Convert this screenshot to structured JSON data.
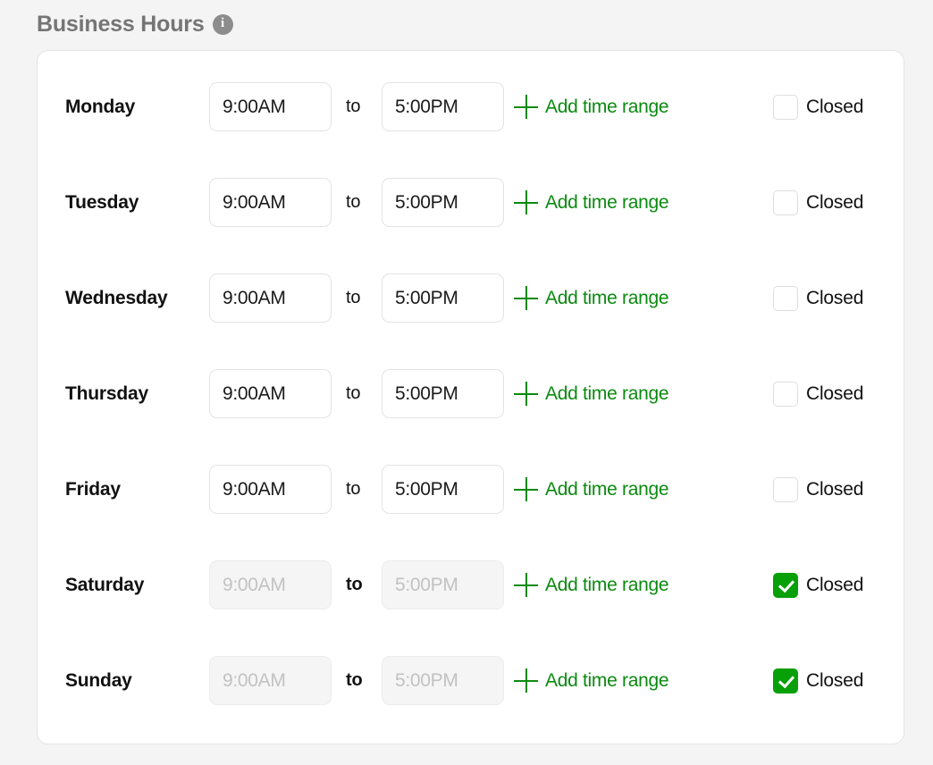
{
  "header": {
    "title": "Business Hours",
    "info_icon": "info-icon",
    "info_glyph": "i"
  },
  "labels": {
    "to": "to",
    "add_time_range": "Add time range",
    "closed": "Closed",
    "plus_icon": "plus-icon"
  },
  "colors": {
    "page_background": "#f4f4f4",
    "card_background": "#ffffff",
    "card_border": "#e4e4e4",
    "accent_green": "#0b8a10",
    "checkbox_checked": "#08a008",
    "title_gray": "#757575",
    "disabled_text": "#c2c2c2",
    "disabled_input_background": "#f5f5f5"
  },
  "rows": [
    {
      "day": "Monday",
      "start_time": "9:00AM",
      "end_time": "5:00PM",
      "add_time_range": "Add time range",
      "to": "to",
      "closed_label": "Closed",
      "closed": false,
      "disabled": false
    },
    {
      "day": "Tuesday",
      "start_time": "9:00AM",
      "end_time": "5:00PM",
      "add_time_range": "Add time range",
      "to": "to",
      "closed_label": "Closed",
      "closed": false,
      "disabled": false
    },
    {
      "day": "Wednesday",
      "start_time": "9:00AM",
      "end_time": "5:00PM",
      "add_time_range": "Add time range",
      "to": "to",
      "closed_label": "Closed",
      "closed": false,
      "disabled": false
    },
    {
      "day": "Thursday",
      "start_time": "9:00AM",
      "end_time": "5:00PM",
      "add_time_range": "Add time range",
      "to": "to",
      "closed_label": "Closed",
      "closed": false,
      "disabled": false
    },
    {
      "day": "Friday",
      "start_time": "9:00AM",
      "end_time": "5:00PM",
      "add_time_range": "Add time range",
      "to": "to",
      "closed_label": "Closed",
      "closed": false,
      "disabled": false
    },
    {
      "day": "Saturday",
      "start_time": "9:00AM",
      "end_time": "5:00PM",
      "add_time_range": "Add time range",
      "to": "to",
      "closed_label": "Closed",
      "closed": true,
      "disabled": true
    },
    {
      "day": "Sunday",
      "start_time": "9:00AM",
      "end_time": "5:00PM",
      "add_time_range": "Add time range",
      "to": "to",
      "closed_label": "Closed",
      "closed": true,
      "disabled": true
    }
  ]
}
